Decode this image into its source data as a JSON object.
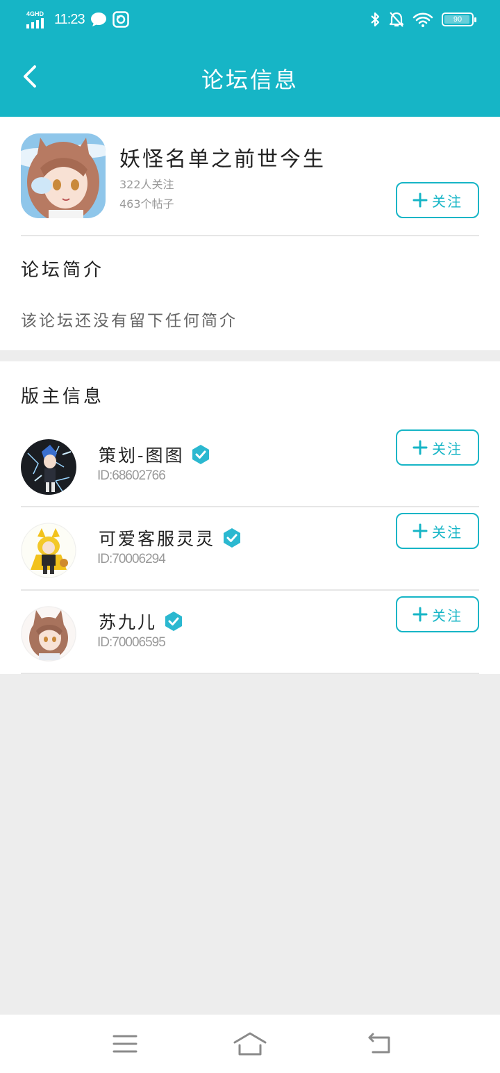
{
  "status": {
    "network": "4GHD",
    "time": "11:23",
    "battery": "90"
  },
  "header": {
    "title": "论坛信息"
  },
  "forum": {
    "name": "妖怪名单之前世今生",
    "followers": "322人关注",
    "posts": "463个帖子",
    "follow_label": "关注"
  },
  "intro": {
    "title": "论坛简介",
    "text": "该论坛还没有留下任何简介"
  },
  "moderators": {
    "title": "版主信息",
    "items": [
      {
        "name": "策划-图图",
        "id": "ID:68602766",
        "follow_label": "关注"
      },
      {
        "name": "可爱客服灵灵",
        "id": "ID:70006294",
        "follow_label": "关注"
      },
      {
        "name": "苏九儿",
        "id": "ID:70006595",
        "follow_label": "关注"
      }
    ]
  },
  "colors": {
    "accent": "#16b5c6",
    "background": "#ededed",
    "divider": "#e6e6e6"
  }
}
